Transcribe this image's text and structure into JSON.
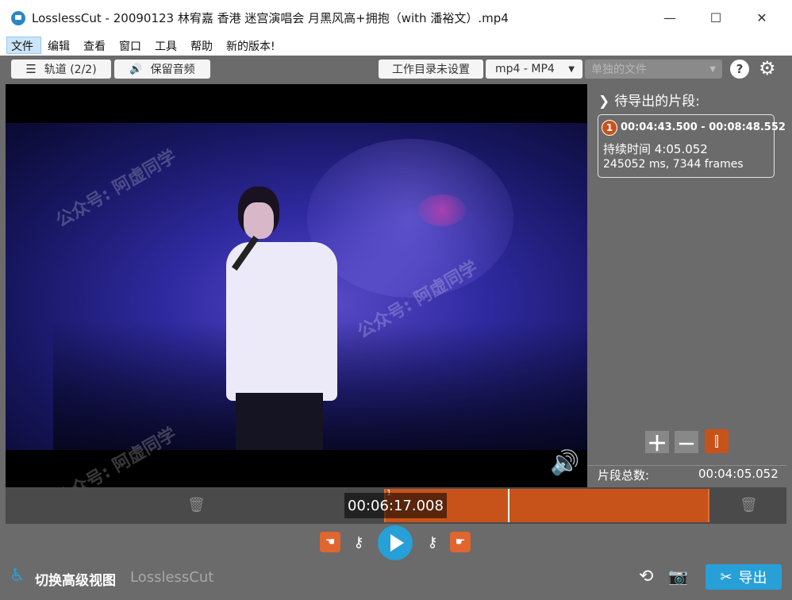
{
  "window": {
    "title": "LosslessCut - 20090123 林宥嘉 香港 迷宫演唱会 月黑风高+拥抱（with 潘裕文）.mp4",
    "minimize": "—",
    "maximize": "☐",
    "close": "✕"
  },
  "menu": [
    "文件",
    "编辑",
    "查看",
    "窗口",
    "工具",
    "帮助",
    "新的版本!"
  ],
  "toolbar": {
    "tracks_label": "轨道 (2/2)",
    "keep_audio_label": "保留音频",
    "workdir_label": "工作目录未设置",
    "format_value": "mp4 - MP4",
    "output_mode_placeholder": "单独的文件",
    "help": "?",
    "settings": "⚙"
  },
  "segments_panel": {
    "title": "待导出的片段:",
    "segment": {
      "index": "1",
      "range": "00:04:43.500 - 00:08:48.552",
      "duration": "持续时间 4:05.052",
      "details": "245052 ms, 7344 frames"
    },
    "total_label": "片段总数:",
    "total_value": "00:04:05.052"
  },
  "timeline": {
    "current_time": "00:06:17.008",
    "segment_marker": "1"
  },
  "bottom": {
    "toggle_label": "切换高级视图",
    "app_name": "LosslessCut",
    "export_label": "导出"
  },
  "watermark": "公众号: 阿虚同学",
  "colors": {
    "accent_blue": "#27a0d8",
    "segment_orange": "#c8531a",
    "panel_gray": "#6b6b6b"
  }
}
